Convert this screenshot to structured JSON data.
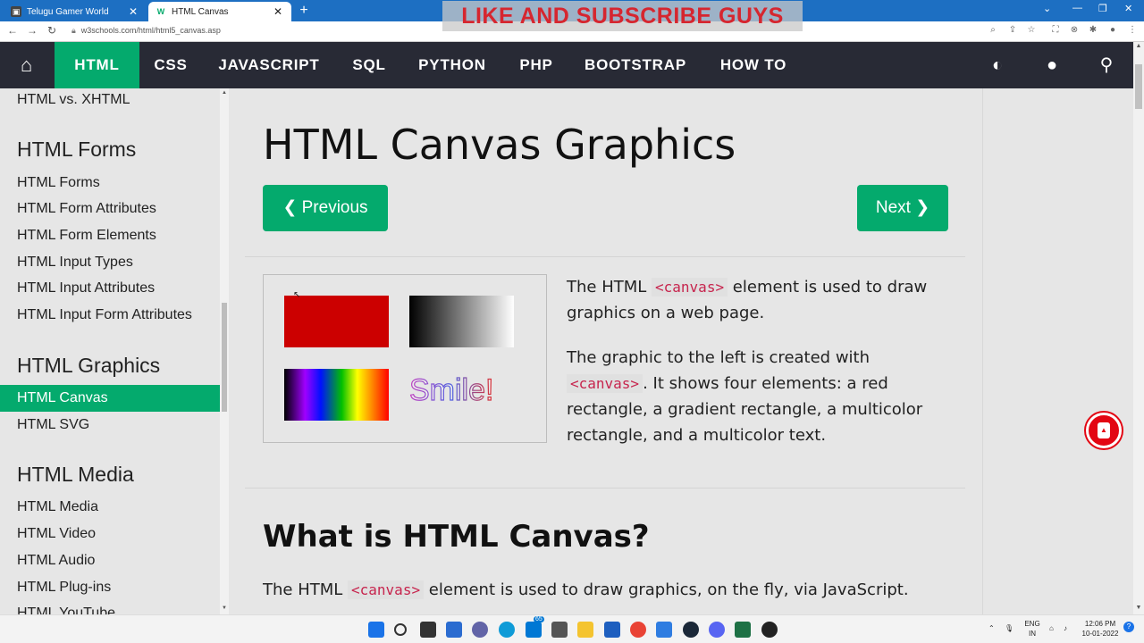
{
  "browser": {
    "tabs": [
      {
        "title": "Telugu Gamer World",
        "active": false
      },
      {
        "title": "HTML Canvas",
        "active": true
      }
    ],
    "url": "w3schools.com/html/html5_canvas.asp",
    "overlay_text": "LIKE AND SUBSCRIBE GUYS"
  },
  "topnav": {
    "items": [
      "HTML",
      "CSS",
      "JAVASCRIPT",
      "SQL",
      "PYTHON",
      "PHP",
      "BOOTSTRAP",
      "HOW TO"
    ],
    "active": "HTML"
  },
  "sidebar": {
    "top_link": "HTML vs. XHTML",
    "forms_heading": "HTML Forms",
    "forms_links": [
      "HTML Forms",
      "HTML Form Attributes",
      "HTML Form Elements",
      "HTML Input Types",
      "HTML Input Attributes",
      "HTML Input Form Attributes"
    ],
    "graphics_heading": "HTML Graphics",
    "graphics_links": [
      "HTML Canvas",
      "HTML SVG"
    ],
    "active_link": "HTML Canvas",
    "media_heading": "HTML Media",
    "media_links": [
      "HTML Media",
      "HTML Video",
      "HTML Audio",
      "HTML Plug-ins",
      "HTML YouTube"
    ]
  },
  "main": {
    "title": "HTML Canvas Graphics",
    "prev_label": "❮ Previous",
    "next_label": "Next ❯",
    "demo_text": "Smile!",
    "intro_p1_a": "The HTML ",
    "intro_code": "<canvas>",
    "intro_p1_b": " element is used to draw graphics on a web page.",
    "intro_p2_a": "The graphic to the left is created with ",
    "intro_p2_b": ". It shows four elements: a red rectangle, a gradient rectangle, a multicolor rectangle, and a multicolor text.",
    "section_heading": "What is HTML Canvas?",
    "section_p_a": "The HTML ",
    "section_p_b": " element is used to draw graphics, on the fly, via JavaScript."
  },
  "taskbar": {
    "lang_top": "ENG",
    "lang_bottom": "IN",
    "time": "12:06 PM",
    "date": "10-01-2022",
    "mail_badge": "65"
  },
  "colors": {
    "w3_green": "#04aa6d",
    "nav_dark": "#282a35",
    "chrome_blue": "#1d6fc2",
    "code_red": "#c7254e"
  }
}
